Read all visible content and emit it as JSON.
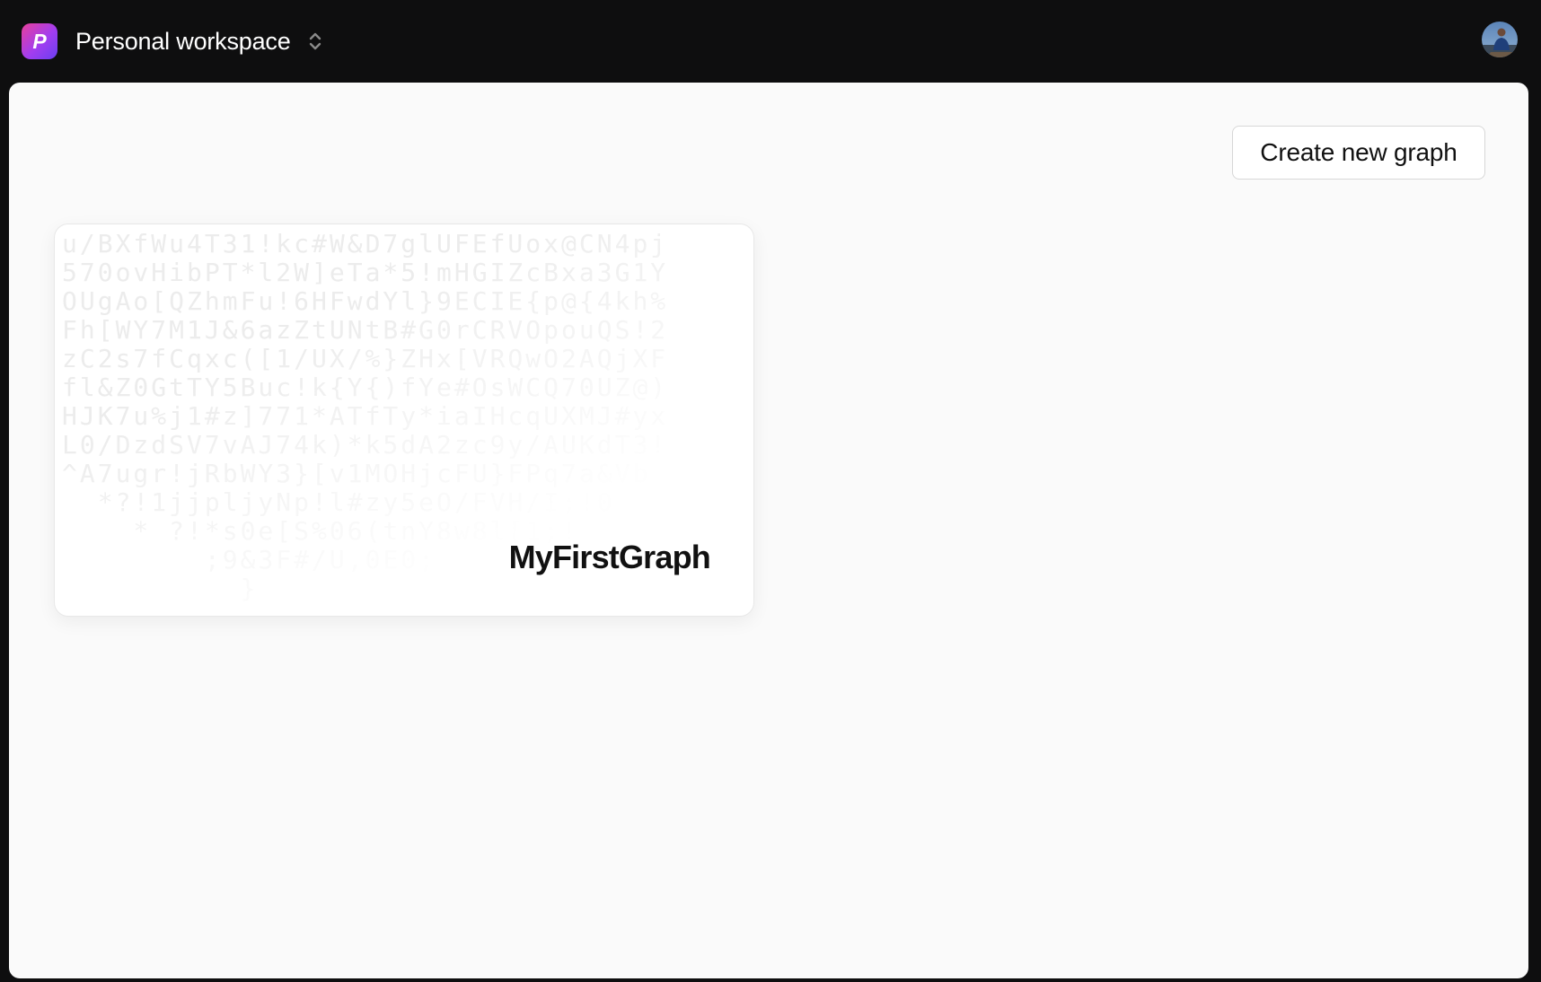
{
  "header": {
    "logo_letter": "P",
    "workspace_name": "Personal workspace",
    "switcher_icon": "chevron-up-down-icon",
    "avatar_icon": "user-avatar"
  },
  "toolbar": {
    "create_label": "Create new graph"
  },
  "graphs": [
    {
      "title": "MyFirstGraph",
      "preview_text": "u/BXfWu4T31!kc#W&D7glUFEfUox@CN4pj\n570ovHibPT*l2W]eTa*5!mHGIZcBxa3G1Y\nOUgAo[QZhmFu!6HFwdYl}9ECIE{p@{4kh%\nFh[WY7M1J&6azZtUNtB#G0rCRVOpouQS!2\nzC2s7fCqxc([1/UX/%}ZHx[VRQwO2AQjXF\nfl&Z0GtTY5Buc!k{Y{)fYe#OsWCQ70UZ@)\nHJK7u%j1#z]771*ATfTy*iaIHcqUXMJ#yx\nL0/DzdSV7vAJ74k)*k5dA2zc9y/AUKdT3!\n^A7ugr!jRbWY3}[v1MOHjcFU}FPq7a&Vb\n  *?!1jjpljyNp!l#zy5eO/FVH/I;!0\n    * ?!*s0e[S%06(tnY8w8l[1;!\n        ;9&3F#/U,0E0;\n          }"
    }
  ],
  "colors": {
    "topbar_bg": "#0e0e0f",
    "main_bg": "#fafafa",
    "logo_gradient_start": "#e8409b",
    "logo_gradient_end": "#6a3ff2"
  }
}
